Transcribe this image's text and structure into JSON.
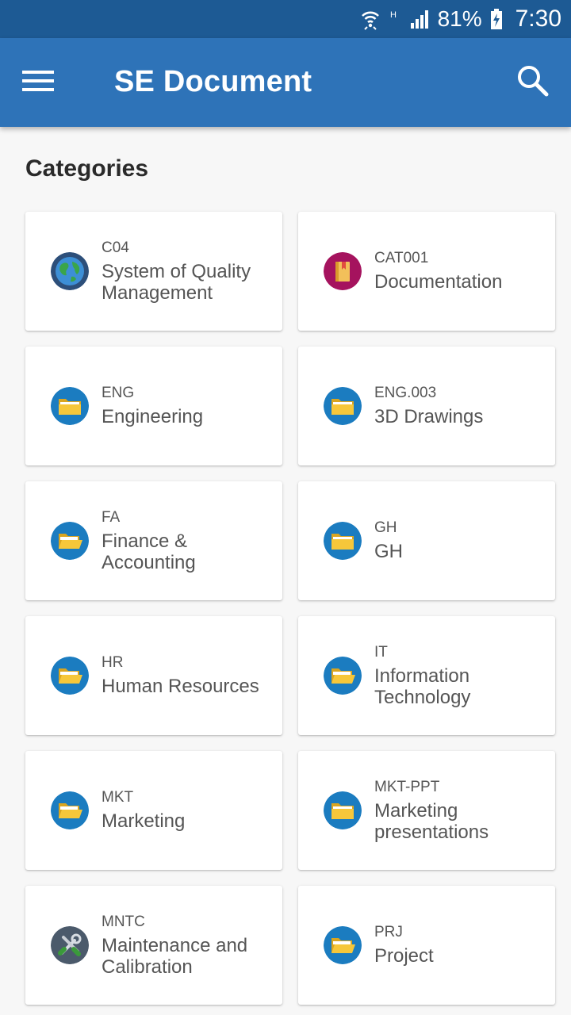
{
  "status_bar": {
    "battery_percent": "81%",
    "time": "7:30",
    "icons": [
      "wifi-icon",
      "hplus-icon",
      "signal-icon",
      "battery-charging-icon"
    ]
  },
  "app_bar": {
    "title": "SE Document",
    "background_color": "#2e73b8",
    "status_color": "#1d5a94"
  },
  "categories": {
    "heading": "Categories",
    "items": [
      {
        "code": "C04",
        "name_lines": [
          "System of Quality",
          "Management"
        ],
        "icon": "globe-icon"
      },
      {
        "code": "CAT001",
        "name_lines": [
          "Documentation"
        ],
        "icon": "book-icon"
      },
      {
        "code": "ENG",
        "name_lines": [
          "Engineering"
        ],
        "icon": "folder-icon"
      },
      {
        "code": "ENG.003",
        "name_lines": [
          "3D Drawings"
        ],
        "icon": "folder-icon"
      },
      {
        "code": "FA",
        "name_lines": [
          "Finance &",
          "Accounting"
        ],
        "icon": "folder-open-icon"
      },
      {
        "code": "GH",
        "name_lines": [
          "GH"
        ],
        "icon": "folder-icon"
      },
      {
        "code": "HR",
        "name_lines": [
          "Human Resources"
        ],
        "icon": "folder-open-icon"
      },
      {
        "code": "IT",
        "name_lines": [
          "Information",
          "Technology"
        ],
        "icon": "folder-open-icon"
      },
      {
        "code": "MKT",
        "name_lines": [
          "Marketing"
        ],
        "icon": "folder-open-icon"
      },
      {
        "code": "MKT-PPT",
        "name_lines": [
          "Marketing",
          "presentations"
        ],
        "icon": "folder-icon"
      },
      {
        "code": "MNTC",
        "name_lines": [
          "Maintenance and",
          "Calibration"
        ],
        "icon": "tools-icon"
      },
      {
        "code": "PRJ",
        "name_lines": [
          "Project"
        ],
        "icon": "folder-open-icon"
      }
    ]
  }
}
